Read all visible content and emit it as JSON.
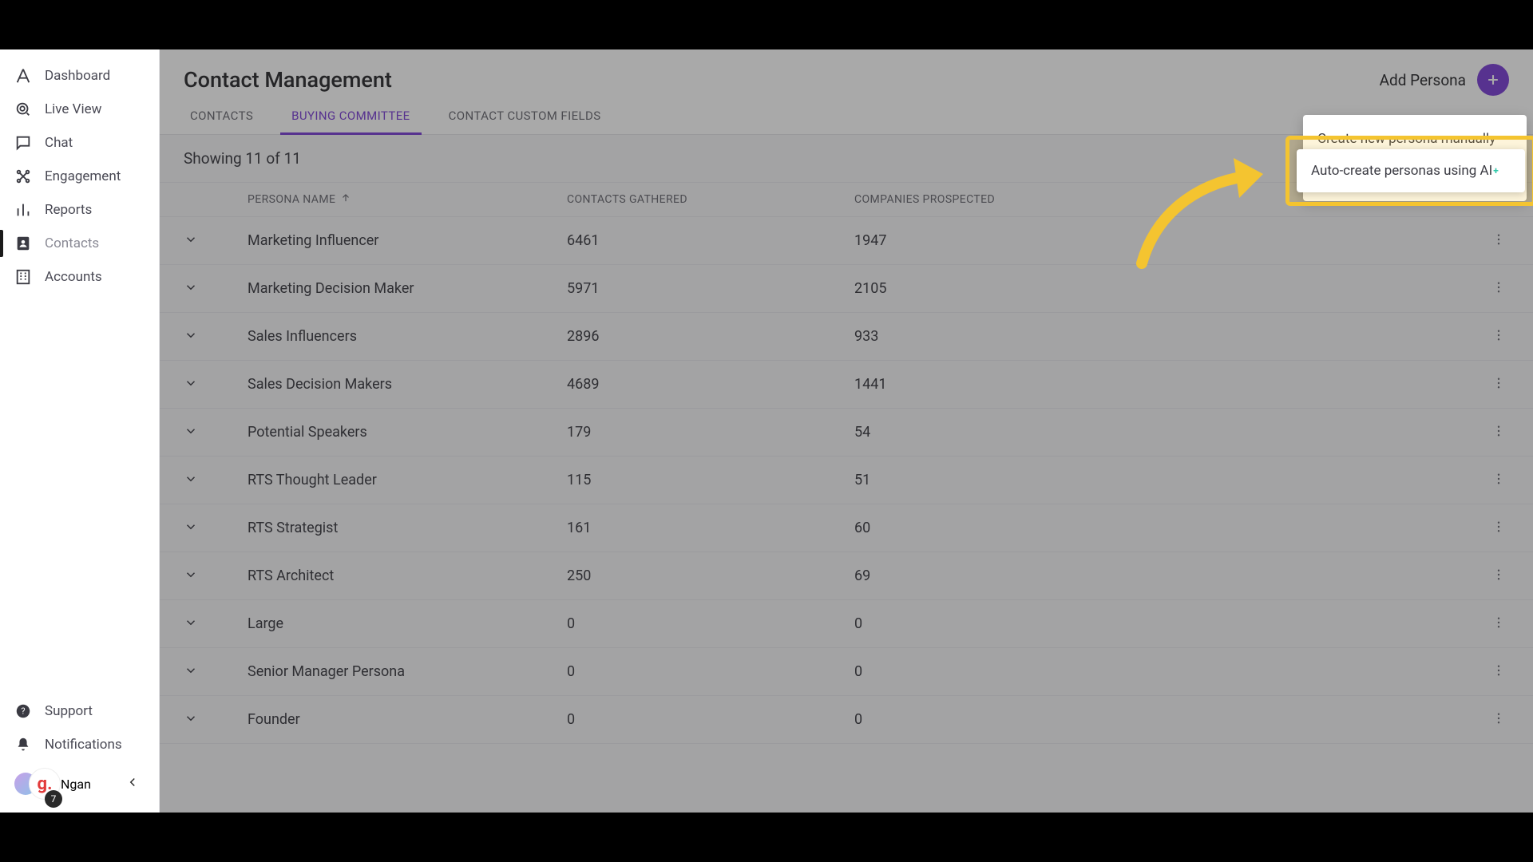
{
  "sidebar": {
    "items": [
      {
        "label": "Dashboard"
      },
      {
        "label": "Live View"
      },
      {
        "label": "Chat"
      },
      {
        "label": "Engagement"
      },
      {
        "label": "Reports"
      },
      {
        "label": "Contacts"
      },
      {
        "label": "Accounts"
      }
    ],
    "support": "Support",
    "notifications": "Notifications",
    "user_initial": "g.",
    "user_name": "Ngan",
    "badge": "7"
  },
  "header": {
    "title": "Contact Management",
    "add_label": "Add Persona",
    "tabs": [
      {
        "label": "CONTACTS"
      },
      {
        "label": "BUYING COMMITTEE"
      },
      {
        "label": "CONTACT CUSTOM FIELDS"
      }
    ]
  },
  "content": {
    "showing": "Showing 11 of 11",
    "columns": {
      "c1": "PERSONA NAME",
      "c2": "CONTACTS GATHERED",
      "c3": "COMPANIES PROSPECTED"
    },
    "rows": [
      {
        "name": "Marketing Influencer",
        "contacts": "6461",
        "companies": "1947"
      },
      {
        "name": "Marketing Decision Maker",
        "contacts": "5971",
        "companies": "2105"
      },
      {
        "name": "Sales Influencers",
        "contacts": "2896",
        "companies": "933"
      },
      {
        "name": "Sales Decision Makers",
        "contacts": "4689",
        "companies": "1441"
      },
      {
        "name": "Potential Speakers",
        "contacts": "179",
        "companies": "54"
      },
      {
        "name": "RTS Thought Leader",
        "contacts": "115",
        "companies": "51"
      },
      {
        "name": "RTS Strategist",
        "contacts": "161",
        "companies": "60"
      },
      {
        "name": "RTS Architect",
        "contacts": "250",
        "companies": "69"
      },
      {
        "name": "Large",
        "contacts": "0",
        "companies": "0"
      },
      {
        "name": "Senior Manager Persona",
        "contacts": "0",
        "companies": "0"
      },
      {
        "name": "Founder",
        "contacts": "0",
        "companies": "0"
      }
    ]
  },
  "dropdown": {
    "item1": "Create new persona manually",
    "item2_text": "Auto-create personas using AI",
    "item2_sup": "+"
  },
  "colors": {
    "accent": "#7b3fd6",
    "highlight": "#f4c430",
    "ai_teal": "#2dc9aa"
  }
}
